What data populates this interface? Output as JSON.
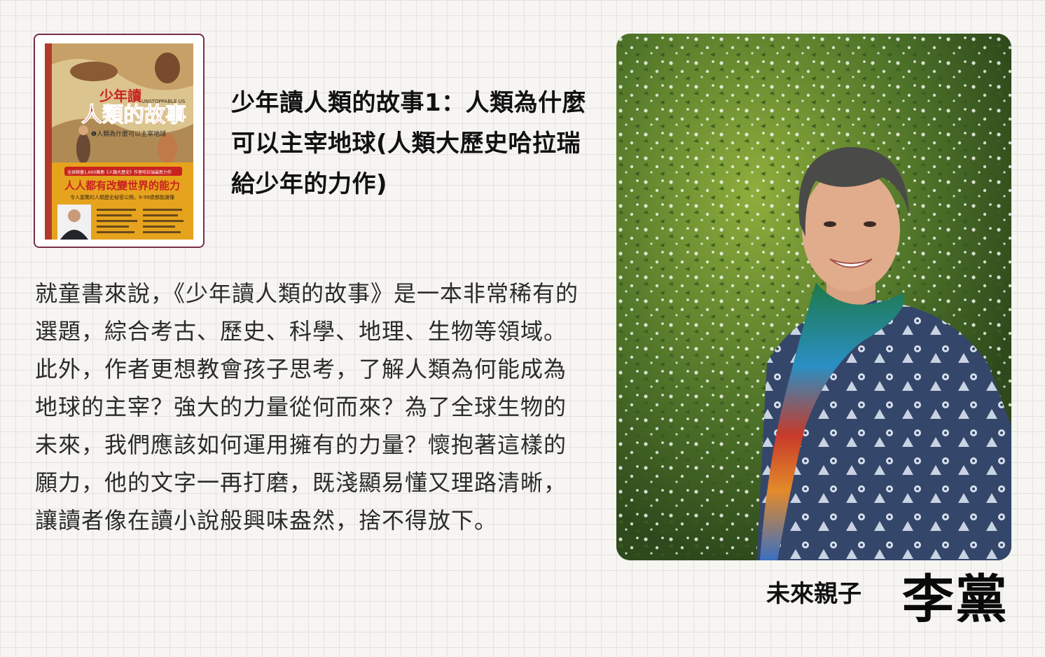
{
  "book": {
    "title": "少年讀人類的故事1：人類為什麼可以主宰地球(人類大歷史哈拉瑞給少年的力作)",
    "cover": {
      "title_line1": "少年讀",
      "title_line2": "人類的故事",
      "subtitle_en": "UNSTOPPABLE US",
      "volume_subtitle": "❶人類為什麼可以主宰地球",
      "banner_top": "全球銷量1,600萬冊《人類大歷史》作者哈拉瑞最新力作",
      "banner_main": "人人都有改變世界的能力",
      "banner_sub": "令人震驚的人類歷史秘密公開，9-99歲都能讀懂",
      "brand_color": "#e6a31d",
      "accent_color": "#c8231f"
    }
  },
  "review": {
    "text": "就童書來說，《少年讀人類的故事》是一本非常稀有的選題，綜合考古、歷史、科學、地理、生物等領域。此外，作者更想教會孩子思考，了解人類為何能成為地球的主宰？強大的力量從何而來？為了全球生物的未來，我們應該如何運用擁有的力量？懷抱著這樣的願力，他的文字一再打磨，既淺顯易懂又理路清晰，讓讀者像在讀小說般興味盎然，捨不得放下。"
  },
  "reviewer": {
    "organization": "未來親子",
    "name": "李黨"
  },
  "colors": {
    "frame_border": "#7a2d4c",
    "background": "#f6f5f2",
    "grid_line": "#e3e2de"
  }
}
